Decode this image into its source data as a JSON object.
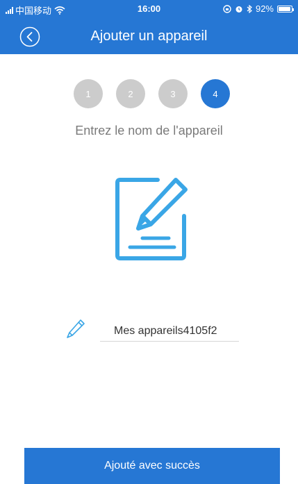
{
  "status_bar": {
    "carrier": "中国移动",
    "time": "16:00",
    "battery_text": "92%",
    "battery_level": 0.92,
    "icons": [
      "signal-icon",
      "wifi-icon",
      "lock-rotation-icon",
      "alarm-icon",
      "bluetooth-icon",
      "battery-icon"
    ]
  },
  "header": {
    "title": "Ajouter un appareil",
    "back_icon": "back-chevron-circle-icon"
  },
  "stepper": {
    "steps": [
      {
        "label": "1",
        "active": false
      },
      {
        "label": "2",
        "active": false
      },
      {
        "label": "3",
        "active": false
      },
      {
        "label": "4",
        "active": true
      }
    ]
  },
  "instruction": "Entrez le nom de l'appareil",
  "illustration_icon": "edit-document-icon",
  "device_name": {
    "value": "Mes appareils4105f2",
    "icon": "pencil-icon"
  },
  "success_button": {
    "label": "Ajouté avec succès"
  },
  "colors": {
    "primary": "#2677d4",
    "step_inactive": "#cccccc",
    "illustration": "#3aa6e6",
    "text_muted": "#7a7a7a"
  }
}
